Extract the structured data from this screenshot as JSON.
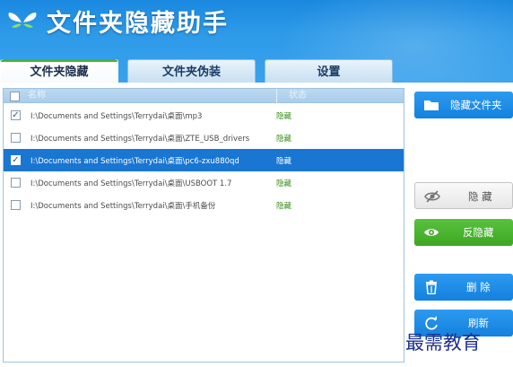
{
  "header": {
    "title": "文件夹隐藏助手",
    "logo": "butterfly-logo"
  },
  "tabs": [
    {
      "label": "文件夹隐藏",
      "active": true
    },
    {
      "label": "文件夹伪装",
      "active": false
    },
    {
      "label": "设置",
      "active": false
    }
  ],
  "list": {
    "columns": {
      "name": "名称",
      "status": "状态"
    },
    "rows": [
      {
        "path": "I:\\Documents and Settings\\Terrydai\\桌面\\mp3",
        "status": "隐藏",
        "checked": true,
        "selected": false
      },
      {
        "path": "I:\\Documents and Settings\\Terrydai\\桌面\\ZTE_USB_drivers",
        "status": "隐藏",
        "checked": false,
        "selected": false
      },
      {
        "path": "I:\\Documents and Settings\\Terrydai\\桌面\\pc6-zxu880qd",
        "status": "隐藏",
        "checked": true,
        "selected": true
      },
      {
        "path": "I:\\Documents and Settings\\Terrydai\\桌面\\USBOOT 1.7",
        "status": "隐藏",
        "checked": false,
        "selected": false
      },
      {
        "path": "I:\\Documents and Settings\\Terrydai\\桌面\\手机备份",
        "status": "隐藏",
        "checked": false,
        "selected": false
      }
    ]
  },
  "buttons": {
    "hide_folder": "隐藏文件夹",
    "hide": "隐 藏",
    "unhide": "反隐藏",
    "delete": "删 除",
    "refresh": "刷新"
  },
  "colors": {
    "header_blue": "#2d9ae8",
    "selection_blue": "#1976d2",
    "status_green": "#3a8f1a",
    "button_green": "#4ab236"
  },
  "watermark": "最需教育"
}
